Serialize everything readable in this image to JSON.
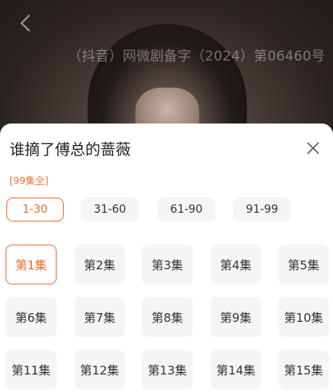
{
  "header": {
    "license_text": "（抖音）网微剧备字（2024）第06460号"
  },
  "sheet": {
    "title": "谁摘了傅总的蔷薇",
    "tag": "[99集全]",
    "ranges": [
      {
        "label": "1-30",
        "active": true
      },
      {
        "label": "31-60",
        "active": false
      },
      {
        "label": "61-90",
        "active": false
      },
      {
        "label": "91-99",
        "active": false
      }
    ],
    "episodes": [
      {
        "label": "第1集",
        "active": true
      },
      {
        "label": "第2集"
      },
      {
        "label": "第3集"
      },
      {
        "label": "第4集"
      },
      {
        "label": "第5集"
      },
      {
        "label": "第6集"
      },
      {
        "label": "第7集"
      },
      {
        "label": "第8集"
      },
      {
        "label": "第9集"
      },
      {
        "label": "第10集"
      },
      {
        "label": "第11集"
      },
      {
        "label": "第12集"
      },
      {
        "label": "第13集"
      },
      {
        "label": "第14集"
      },
      {
        "label": "第15集"
      }
    ]
  },
  "colors": {
    "accent": "#f26a2e",
    "tag": "#e8733f"
  },
  "icons": {
    "back": "chevron-left-icon",
    "close": "close-icon"
  }
}
